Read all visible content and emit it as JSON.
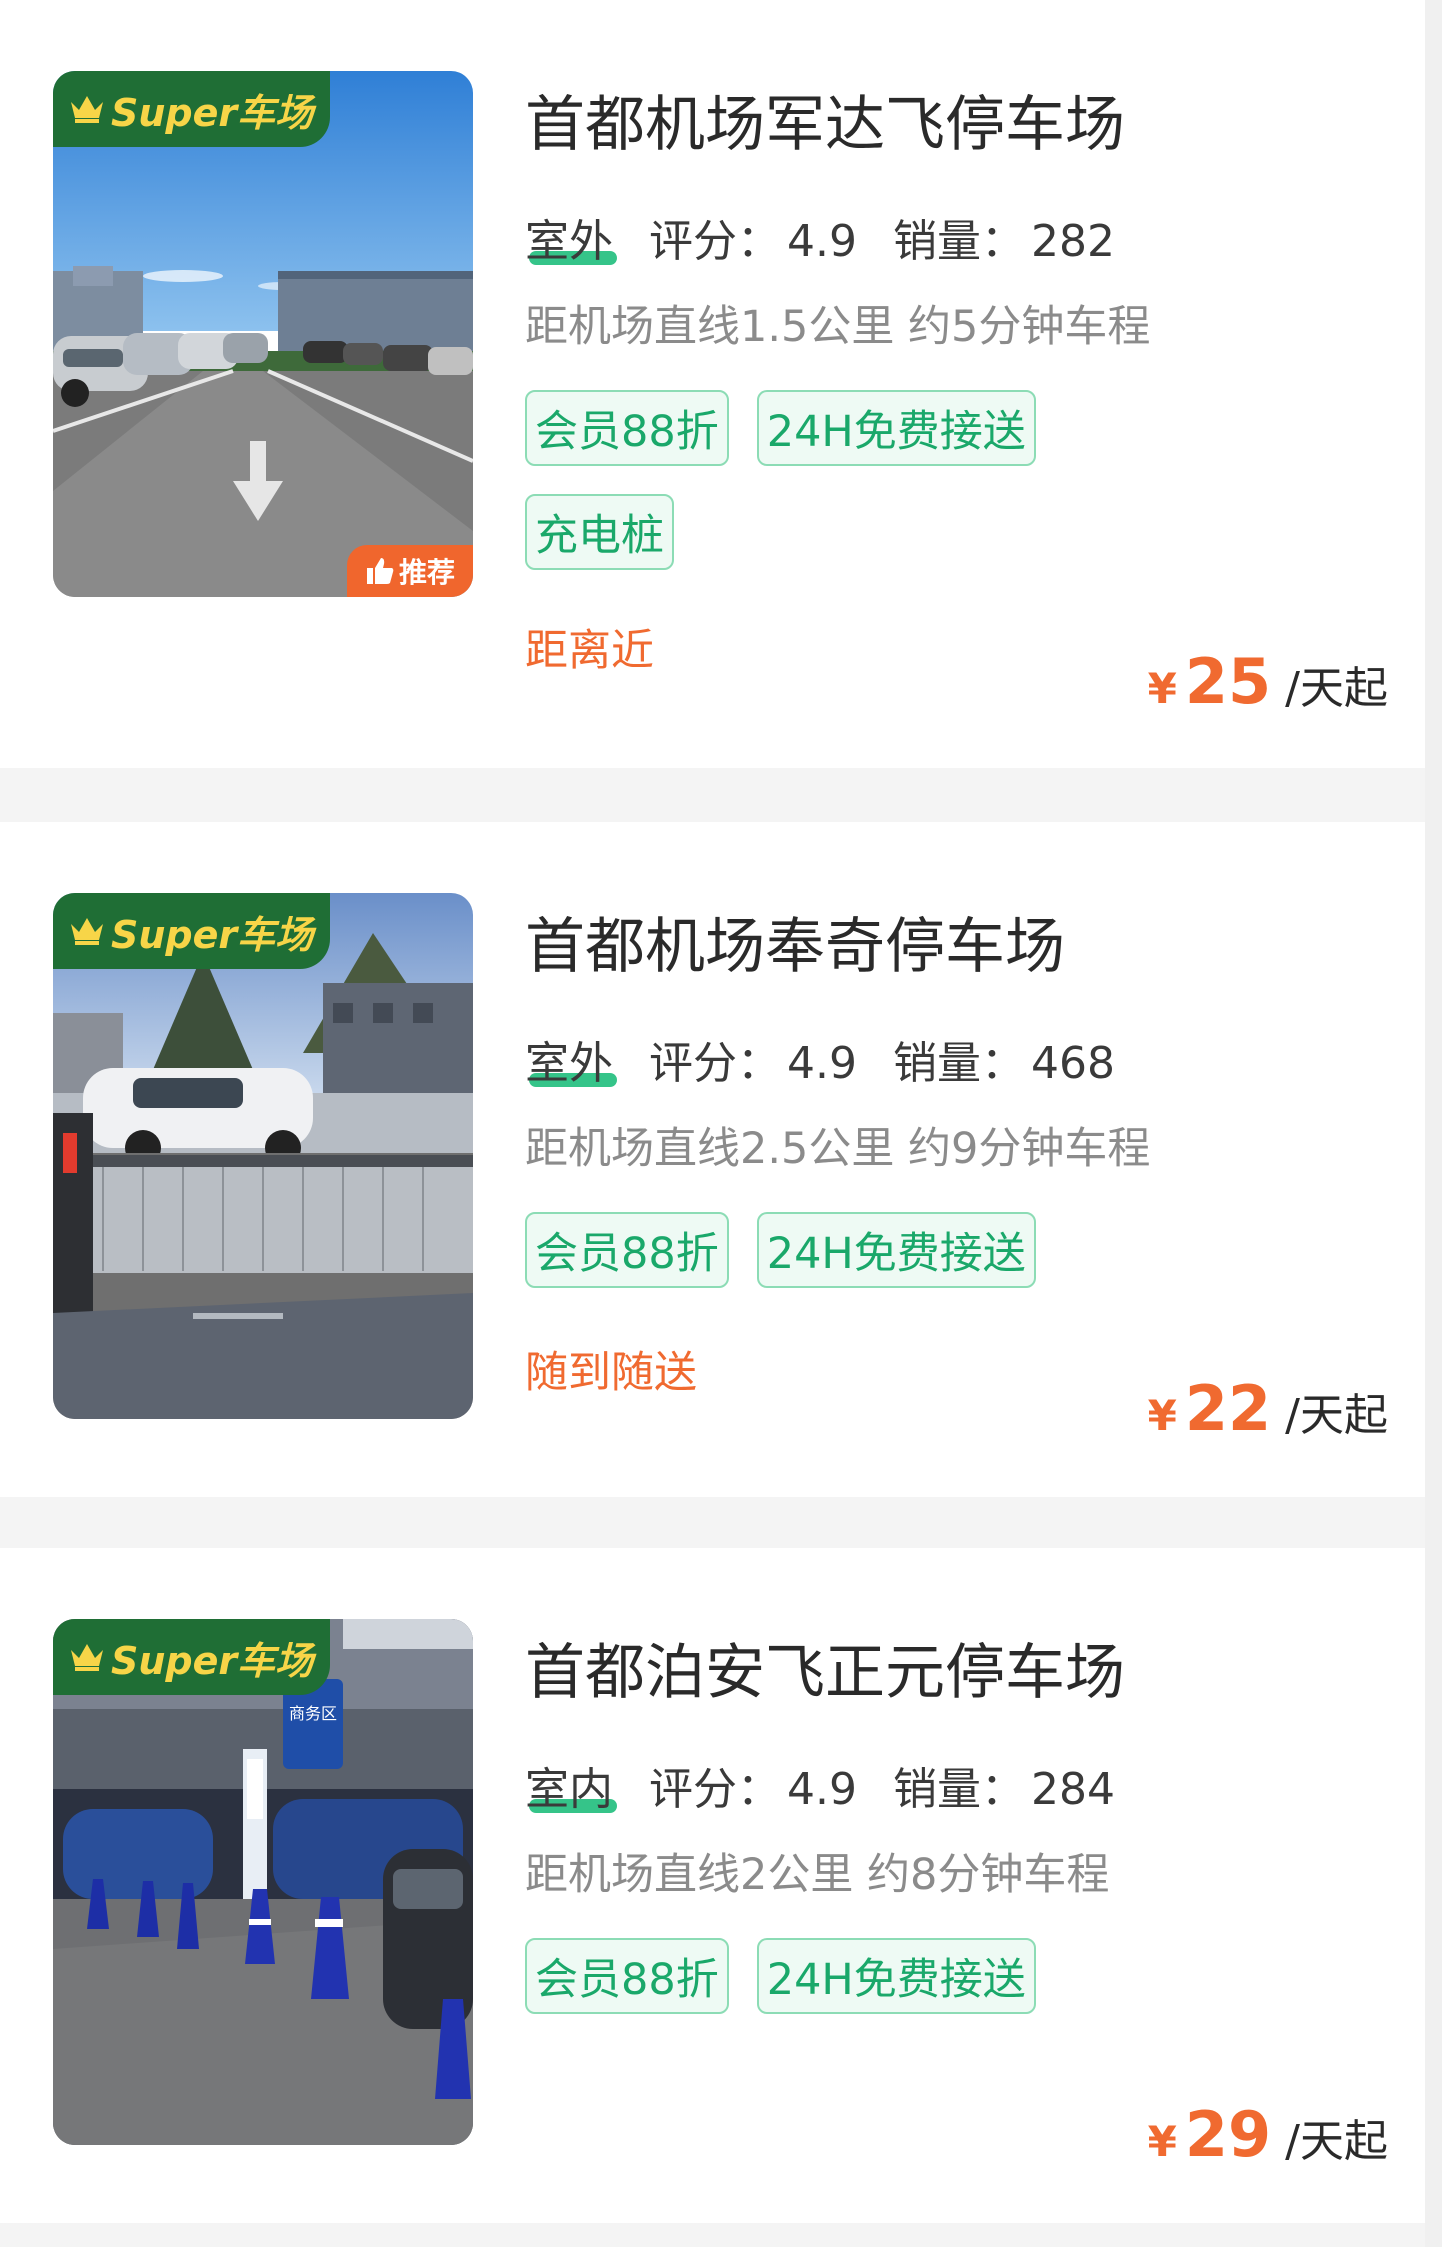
{
  "badges": {
    "super": "Super车场",
    "recommend": "推荐"
  },
  "lots": [
    {
      "name": "首都机场军达飞停车场",
      "location": "室外",
      "rating_label": "评分：",
      "rating": "4.9",
      "sales_label": "销量：",
      "sales": "282",
      "distance": "距机场直线1.5公里 约5分钟车程",
      "tags": [
        "会员88折",
        "24H免费接送",
        "充电桩"
      ],
      "feature": "距离近",
      "currency": "¥",
      "price": "25",
      "unit": "/天起"
    },
    {
      "name": "首都机场奉奇停车场",
      "location": "室外",
      "rating_label": "评分：",
      "rating": "4.9",
      "sales_label": "销量：",
      "sales": "468",
      "distance": "距机场直线2.5公里 约9分钟车程",
      "tags": [
        "会员88折",
        "24H免费接送"
      ],
      "feature": "随到随送",
      "currency": "¥",
      "price": "22",
      "unit": "/天起"
    },
    {
      "name": "首都泊安飞正元停车场",
      "location": "室内",
      "rating_label": "评分：",
      "rating": "4.9",
      "sales_label": "销量：",
      "sales": "284",
      "distance": "距机场直线2公里 约8分钟车程",
      "tags": [
        "会员88折",
        "24H免费接送"
      ],
      "feature": "",
      "currency": "¥",
      "price": "29",
      "unit": "/天起"
    }
  ],
  "photo_sign": "商务区",
  "colors": {
    "accent_green": "#1aa86a",
    "badge_green": "#1f6e35",
    "price_orange": "#f06a30",
    "badge_yellow": "#f7d548"
  }
}
